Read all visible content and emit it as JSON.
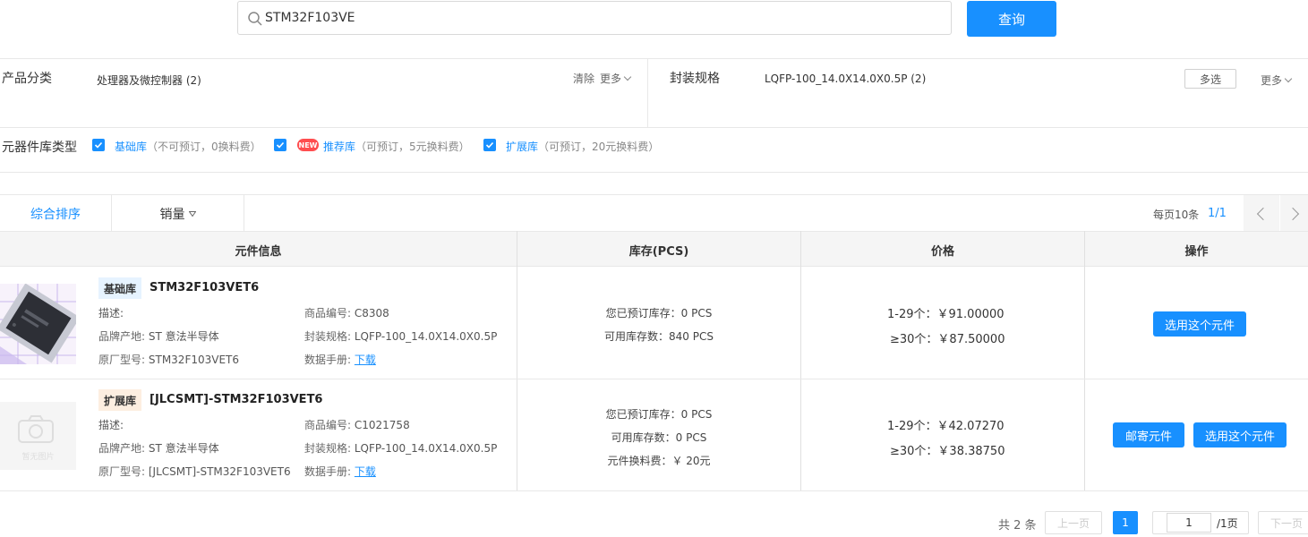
{
  "search": {
    "value": "STM32F103VE",
    "button_label": "查询"
  },
  "filters": {
    "category": {
      "label": "产品分类",
      "option": "处理器及微控制器 (2)",
      "clear_label": "清除",
      "more_label": "更多"
    },
    "package": {
      "label": "封装规格",
      "option": "LQFP-100_14.0X14.0X0.5P (2)",
      "multi_label": "多选",
      "more_label": "更多"
    },
    "library_type": {
      "label": "元器件库类型",
      "items": [
        {
          "name": "基础库",
          "desc": "（不可预订，0换料费）",
          "checked": true
        },
        {
          "name": "推荐库",
          "desc": "（可预订，5元换料费）",
          "checked": true,
          "badge": "NEW"
        },
        {
          "name": "扩展库",
          "desc": "（可预订，20元换料费）",
          "checked": true
        }
      ]
    }
  },
  "sort": {
    "tab_default": "综合排序",
    "tab_sales": "销量",
    "per_page_label": "每页10条",
    "page_indicator": "1/1"
  },
  "table": {
    "headers": {
      "info": "元件信息",
      "stock": "库存(PCS)",
      "price": "价格",
      "action": "操作"
    },
    "rows": [
      {
        "lib_tag": "基础库",
        "title": "STM32F103VET6",
        "desc_label": "描述:",
        "code_label": "商品编号:",
        "code": "C8308",
        "brand_label": "品牌产地:",
        "brand": "ST 意法半导体",
        "package_label": "封装规格:",
        "package": "LQFP-100_14.0X14.0X0.5P",
        "mfr_label": "原厂型号:",
        "mfr": "STM32F103VET6",
        "datasheet_label": "数据手册:",
        "datasheet": "下载",
        "stock_lines": [
          "您已预订库存：0 PCS",
          "可用库存数：840 PCS"
        ],
        "prices": [
          "1-29个：￥91.00000",
          "≥30个：￥87.50000"
        ],
        "actions": [
          "选用这个元件"
        ]
      },
      {
        "lib_tag": "扩展库",
        "title": "[JLCSMT]-STM32F103VET6",
        "no_image_label": "暂无图片",
        "desc_label": "描述:",
        "code_label": "商品编号:",
        "code": "C1021758",
        "brand_label": "品牌产地:",
        "brand": "ST 意法半导体",
        "package_label": "封装规格:",
        "package": "LQFP-100_14.0X14.0X0.5P",
        "mfr_label": "原厂型号:",
        "mfr": "[JLCSMT]-STM32F103VET6",
        "datasheet_label": "数据手册:",
        "datasheet": "下载",
        "stock_lines": [
          "您已预订库存：0 PCS",
          "可用库存数：0 PCS",
          "元件换料费：￥ 20元"
        ],
        "prices": [
          "1-29个：￥42.07270",
          "≥30个：￥38.38750"
        ],
        "actions": [
          "邮寄元件",
          "选用这个元件"
        ]
      }
    ]
  },
  "pagination": {
    "total": "共 2 条",
    "prev": "上一页",
    "current": "1",
    "input_value": "1",
    "total_pages": "/1页",
    "next": "下一页"
  },
  "colors": {
    "accent": "#1890ff",
    "new_badge": "#ff4d4f"
  }
}
